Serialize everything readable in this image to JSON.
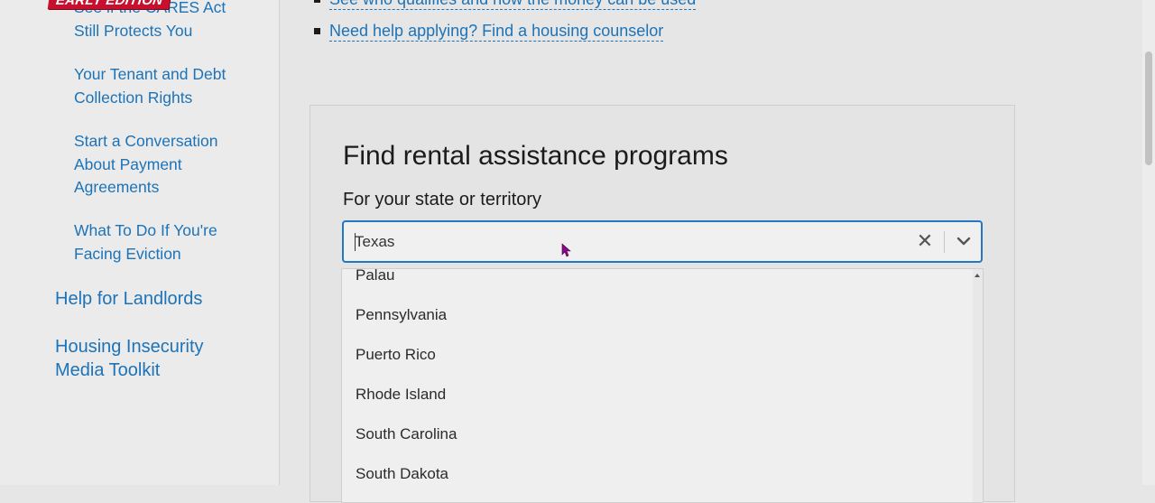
{
  "sidebar": {
    "badge": "EARLY EDITION",
    "partial_link": "See if the CARES Act Still Protects You",
    "sub_links": [
      "Your Tenant and Debt Collection Rights",
      "Start a Conversation About Payment Agreements",
      "What To Do If You're Facing Eviction"
    ],
    "main_links": [
      "Help for Landlords",
      "Housing Insecurity Media Toolkit"
    ]
  },
  "bullets": [
    "See who qualifies and how the money can be used",
    "Need help applying? Find a housing counselor"
  ],
  "finder": {
    "title": "Find rental assistance programs",
    "label": "For your state or territory",
    "selected": "Texas",
    "clear_icon": "close-icon",
    "toggle_icon": "chevron-down-icon",
    "options": [
      "Palau",
      "Pennsylvania",
      "Puerto Rico",
      "Rhode Island",
      "South Carolina",
      "South Dakota"
    ]
  },
  "colors": {
    "link": "#1d73b7",
    "focus_border": "#2378c3",
    "badge": "#c8102e",
    "cursor": "#8b0a8b"
  }
}
